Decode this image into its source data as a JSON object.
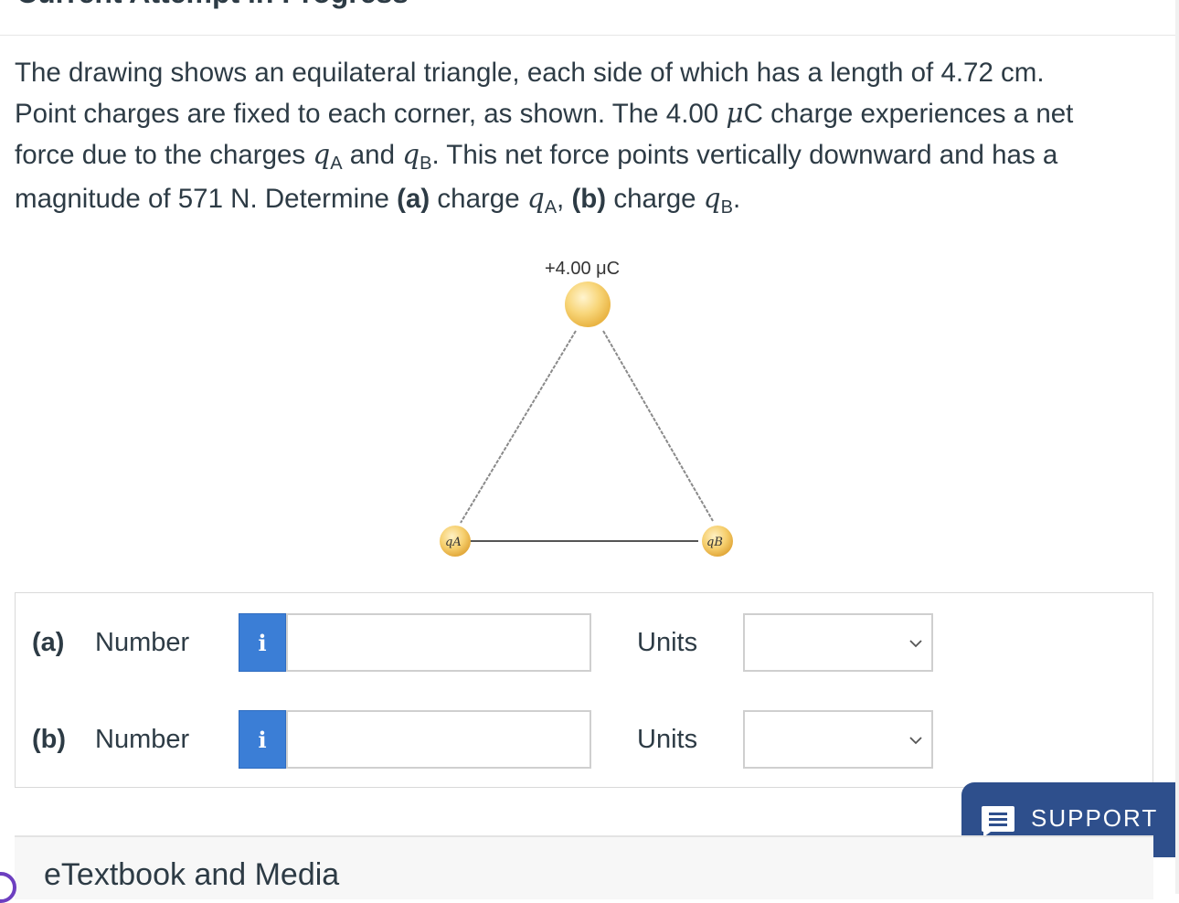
{
  "header": {
    "title": "Current Attempt in Progress"
  },
  "question": {
    "line1": "The drawing shows an equilateral triangle, each side of which has a length of 4.72 cm.",
    "line2_a": "Point charges are fixed to each corner, as shown. The 4.00 ",
    "mu": "μ",
    "line2_b": "C charge experiences a net",
    "line3_a": "force due to the charges ",
    "qa_sym": "q",
    "qa_sub": "A",
    "line3_b": " and ",
    "qb_sym": "q",
    "qb_sub": "B",
    "line3_c": ". This net force points vertically downward and has a",
    "line4_a": "magnitude of 571 N. Determine ",
    "part_a": "(a)",
    "line4_b": " charge ",
    "comma": ", ",
    "part_b": "(b)",
    "line4_c": " charge ",
    "period": "."
  },
  "figure": {
    "top_charge_label": "+4.00 μC",
    "left_charge_label": "qA",
    "right_charge_label": "qB"
  },
  "answers": [
    {
      "part": "(a)",
      "number_label": "Number",
      "info_icon": "i",
      "number_value": "",
      "units_label": "Units",
      "units_value": ""
    },
    {
      "part": "(b)",
      "number_label": "Number",
      "info_icon": "i",
      "number_value": "",
      "units_label": "Units",
      "units_value": ""
    }
  ],
  "support": {
    "label": "SUPPORT",
    "icon": "chat-icon"
  },
  "etextbook": {
    "label": "eTextbook and Media"
  },
  "colors": {
    "info_button": "#3b7ed6",
    "support_bg": "#2e4f8c",
    "charge_fill": "#f6cf6e"
  }
}
